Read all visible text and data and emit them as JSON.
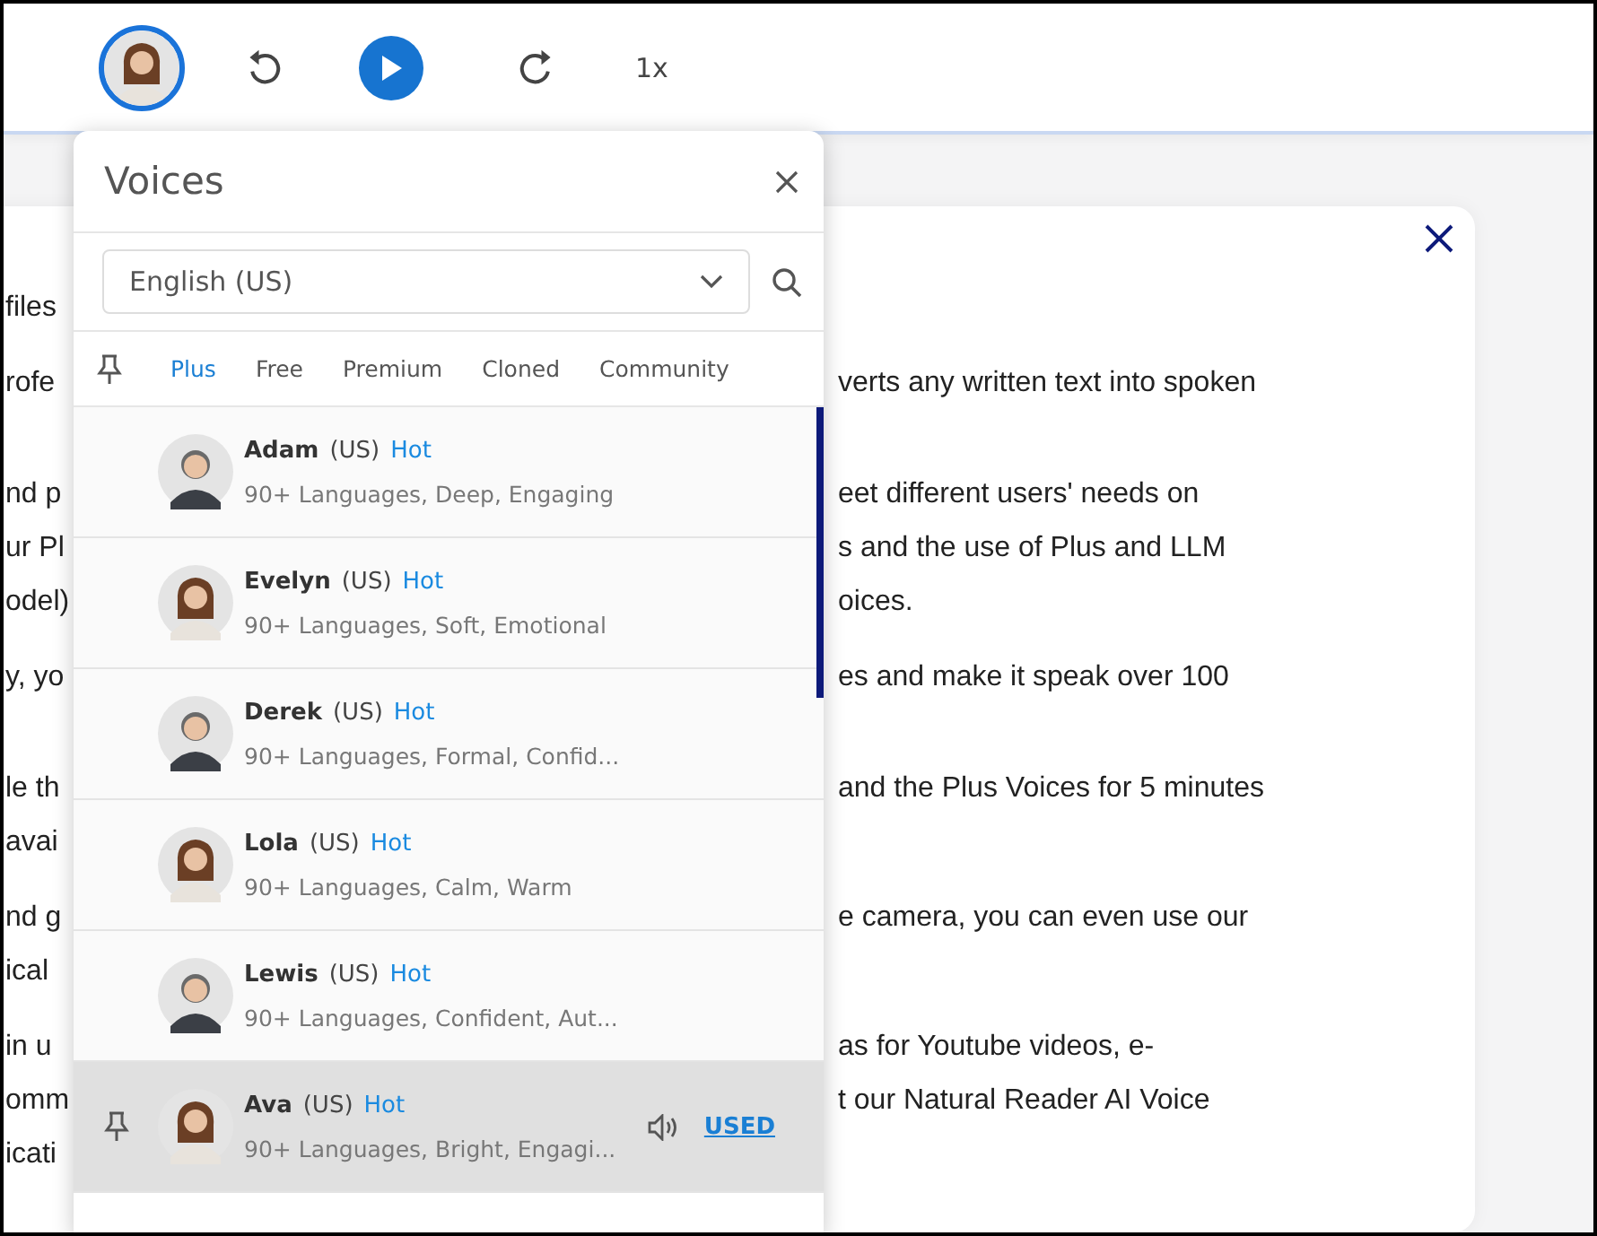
{
  "player": {
    "speed": "1x"
  },
  "document": {
    "paragraphs": [
      {
        "lines": [
          {
            "left": "files"
          }
        ]
      },
      {
        "lines": [
          {
            "left": "rofe",
            "right": "verts any written text into spoken"
          }
        ]
      },
      {
        "lines": [
          {
            "left": "nd p",
            "right": "eet different users' needs on"
          },
          {
            "left": "ur Pl",
            "right": "s and the use of Plus and LLM"
          },
          {
            "left": "odel)",
            "right": "oices."
          }
        ]
      },
      {
        "lines": [
          {
            "left": "y, yo",
            "right": "es and make it speak over 100"
          }
        ]
      },
      {
        "lines": [
          {
            "left": "le th",
            "right": "and the Plus Voices for 5 minutes"
          },
          {
            "left": "avai"
          }
        ]
      },
      {
        "lines": [
          {
            "left": "nd g",
            "right": "e camera, you can even use our"
          },
          {
            "left": "ical"
          }
        ]
      },
      {
        "lines": [
          {
            "left": "in u",
            "right": "as for Youtube videos, e-"
          },
          {
            "left": "omm",
            "right": "t our Natural Reader AI Voice"
          },
          {
            "left": "icati"
          }
        ]
      }
    ]
  },
  "voices_panel": {
    "title": "Voices",
    "language": "English (US)",
    "tabs": [
      {
        "label": "Plus",
        "selected": true
      },
      {
        "label": "Free",
        "selected": false
      },
      {
        "label": "Premium",
        "selected": false
      },
      {
        "label": "Cloned",
        "selected": false
      },
      {
        "label": "Community",
        "selected": false
      }
    ],
    "voices": [
      {
        "name": "Adam",
        "region": "(US)",
        "badge": "Hot",
        "description": "90+ Languages, Deep, Engaging",
        "selected": false
      },
      {
        "name": "Evelyn",
        "region": "(US)",
        "badge": "Hot",
        "description": "90+ Languages, Soft, Emotional",
        "selected": false
      },
      {
        "name": "Derek",
        "region": "(US)",
        "badge": "Hot",
        "description": "90+ Languages, Formal, Confid...",
        "selected": false
      },
      {
        "name": "Lola",
        "region": "(US)",
        "badge": "Hot",
        "description": "90+ Languages, Calm, Warm",
        "selected": false
      },
      {
        "name": "Lewis",
        "region": "(US)",
        "badge": "Hot",
        "description": "90+ Languages, Confident, Aut...",
        "selected": false
      },
      {
        "name": "Ava",
        "region": "(US)",
        "badge": "Hot",
        "description": "90+ Languages, Bright, Engagi...",
        "selected": true,
        "status": "USED"
      }
    ]
  }
}
